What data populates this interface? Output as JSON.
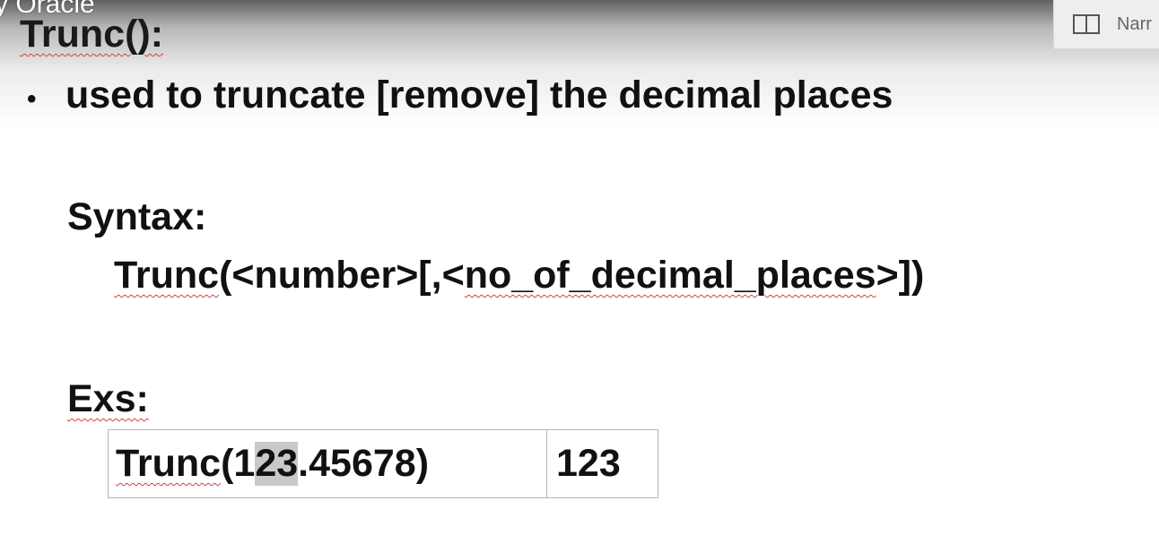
{
  "overlay": {
    "video_title_fragment": "y Oracle",
    "narrator_label": "Narr"
  },
  "slide": {
    "title": "Trunc():",
    "bullet_symbol": "•",
    "bullet_text": "used to truncate [remove] the decimal places",
    "syntax_heading": "Syntax:",
    "syntax_prefix": "Trunc",
    "syntax_middle": "(<number>[,<",
    "syntax_param": "no_of_decimal_places",
    "syntax_suffix": ">])",
    "examples_heading": "Exs:",
    "example": {
      "function_name": "Trunc",
      "open_paren": "(",
      "arg_before_highlight": "1",
      "arg_highlighted": "23",
      "arg_after_highlight": ".45678)",
      "result": "123"
    }
  },
  "colors": {
    "spellcheck_underline": "#d04040",
    "selection_highlight": "#c9c9c9",
    "table_border": "#b5b5b5"
  },
  "icons": {
    "narrator_icon": "book-icon"
  }
}
